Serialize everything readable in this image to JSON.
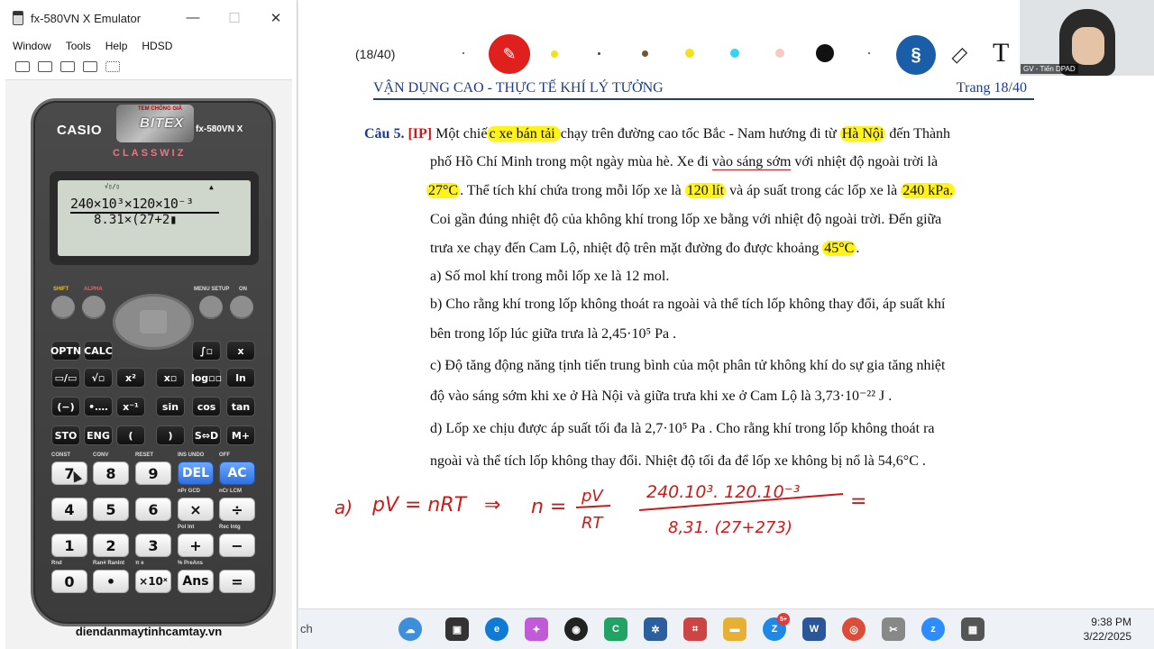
{
  "emulator": {
    "title": "fx-580VN X Emulator",
    "menu": [
      "Window",
      "Tools",
      "Help",
      "HDSD"
    ],
    "calculator": {
      "brand": "CASIO",
      "model": "fx-580VN X",
      "series": "CLASSWIZ",
      "logo_top": "TEM CHỐNG GIẢ",
      "logo_main": "BITEX",
      "screen_indicator": "√▯/▯",
      "screen_numerator": "240×10³×120×10⁻³",
      "screen_denominator": "8.31×(27+2▮",
      "top_labels": {
        "shift": "SHIFT",
        "alpha": "ALPHA",
        "menu": "MENU SETUP",
        "on": "ON"
      },
      "func_rows": [
        [
          "OPTN",
          "CALC",
          "",
          "",
          "∫▫",
          "x"
        ],
        [
          "▭/▭",
          "√▫",
          "x²",
          "x▫",
          "log▫▫",
          "ln"
        ],
        [
          "(−)",
          "•‥‥",
          "x⁻¹",
          "sin",
          "cos",
          "tan"
        ],
        [
          "STO",
          "ENG",
          "(",
          ")",
          "S⇔D",
          "M+"
        ]
      ],
      "num_rows": [
        [
          "7",
          "8",
          "9",
          "DEL",
          "AC"
        ],
        [
          "4",
          "5",
          "6",
          "×",
          "÷"
        ],
        [
          "1",
          "2",
          "3",
          "+",
          "−"
        ],
        [
          "0",
          "•",
          "×10ˣ",
          "Ans",
          "="
        ]
      ],
      "num_sublabels": [
        [
          "CONST",
          "CONV",
          "RESET",
          "INS UNDO",
          "OFF"
        ],
        [
          "",
          "",
          "",
          "nPr GCD",
          "nCr LCM"
        ],
        [
          "",
          "",
          "",
          "Pol Int",
          "Rec Intg"
        ],
        [
          "Rnd",
          "Ran# RanInt",
          "π e",
          "% PreAns",
          ""
        ]
      ]
    },
    "website": "diendanmaytinhcamtay.vn"
  },
  "document": {
    "page_indicator": "(18/40)",
    "header_left": "VẬN DỤNG CAO - THỰC TẾ KHÍ LÝ TƯỞNG",
    "header_right": "Trang 18/40",
    "question": {
      "num": "Câu 5.",
      "tag": "[IP]",
      "line1a": " Một chiế",
      "line1_hl1": "c xe bán tải ",
      "line1b": "chạy trên đường cao tốc Bắc - Nam hướng đi từ ",
      "line1_hl2": "Hà Nội",
      "line1c": " đến Thành",
      "line2a": "phố Hồ Chí Minh trong một ngày mùa hè. Xe đi ",
      "line2_ul": "vào sáng sớm",
      "line2b": " với nhiệt độ ngoài trời là",
      "line3_hl1": "27°C",
      "line3a": ". Thể tích khí chứa trong mỗi lốp xe là ",
      "line3_hl2": "120 lít",
      "line3b": " và áp suất trong các lốp xe là ",
      "line3_hl3": "240 kPa.",
      "line4": "Coi gần đúng nhiệt độ của không khí trong lốp xe bằng với nhiệt độ ngoài trời. Đến giữa",
      "line5a": "trưa xe chạy đến Cam Lộ, nhiệt độ trên mặt đường đo được khoảng ",
      "line5_hl": "45°C",
      "line5b": ".",
      "a": "a) Số mol khí trong mỗi lốp xe là 12 mol.",
      "b1": "b) Cho rằng khí trong lốp không thoát ra ngoài và thể tích lốp không thay đổi, áp suất khí",
      "b2": "bên trong lốp lúc giữa trưa là  2,45·10⁵ Pa .",
      "c1": "c) Độ tăng động năng tịnh tiến trung bình của một phân tử không khí do sự gia tăng nhiệt",
      "c2": "độ vào sáng sớm khi xe ở Hà Nội và giữa trưa khi xe ở Cam Lộ là  3,73·10⁻²² J .",
      "d1": "d) Lốp xe chịu được áp suất tối đa là  2,7·10⁵ Pa . Cho rằng khí trong lốp không thoát ra",
      "d2": "ngoài và thể tích lốp không thay đổi. Nhiệt độ tối đa để lốp xe không bị nổ là  54,6°C ."
    },
    "handwriting": {
      "label": "a)",
      "eq1": "pV = nRT",
      "arrow": "⇒",
      "eq2_lhs": "n =",
      "eq2_num": "pV",
      "eq2_den": "RT",
      "eq3_num": "240.10³. 120.10⁻³",
      "eq3_den": "8,31. (27+273)",
      "eq_end": "="
    },
    "webcam_tag": "GV - Tiến DPAD"
  },
  "taskbar": {
    "search": "ch",
    "time": "9:38 PM",
    "date": "3/22/2025",
    "zalo_badge": "5+"
  },
  "colors": {
    "highlight": "#fff31a",
    "header_blue": "#1f3c8a",
    "pen_red": "#d01818",
    "calc_blue_key": "#2f6fe0"
  }
}
